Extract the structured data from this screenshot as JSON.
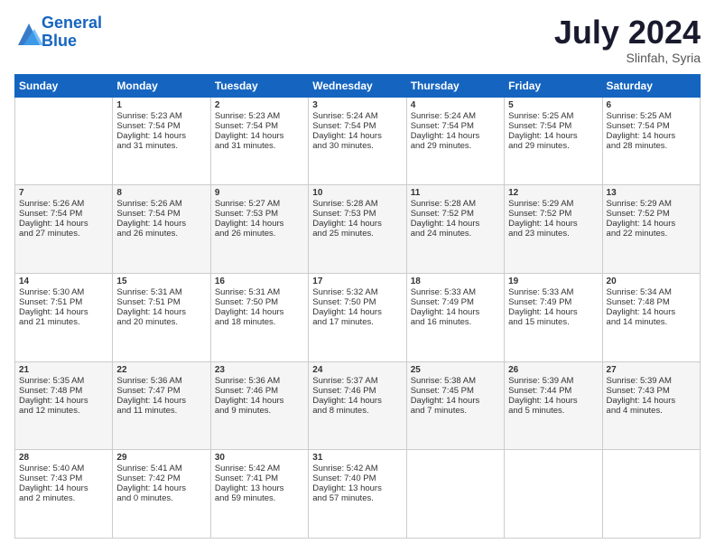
{
  "logo": {
    "line1": "General",
    "line2": "Blue"
  },
  "title": "July 2024",
  "location": "Slinfah, Syria",
  "days_of_week": [
    "Sunday",
    "Monday",
    "Tuesday",
    "Wednesday",
    "Thursday",
    "Friday",
    "Saturday"
  ],
  "weeks": [
    [
      {
        "day": "",
        "info": ""
      },
      {
        "day": "1",
        "info": "Sunrise: 5:23 AM\nSunset: 7:54 PM\nDaylight: 14 hours\nand 31 minutes."
      },
      {
        "day": "2",
        "info": "Sunrise: 5:23 AM\nSunset: 7:54 PM\nDaylight: 14 hours\nand 31 minutes."
      },
      {
        "day": "3",
        "info": "Sunrise: 5:24 AM\nSunset: 7:54 PM\nDaylight: 14 hours\nand 30 minutes."
      },
      {
        "day": "4",
        "info": "Sunrise: 5:24 AM\nSunset: 7:54 PM\nDaylight: 14 hours\nand 29 minutes."
      },
      {
        "day": "5",
        "info": "Sunrise: 5:25 AM\nSunset: 7:54 PM\nDaylight: 14 hours\nand 29 minutes."
      },
      {
        "day": "6",
        "info": "Sunrise: 5:25 AM\nSunset: 7:54 PM\nDaylight: 14 hours\nand 28 minutes."
      }
    ],
    [
      {
        "day": "7",
        "info": "Sunrise: 5:26 AM\nSunset: 7:54 PM\nDaylight: 14 hours\nand 27 minutes."
      },
      {
        "day": "8",
        "info": "Sunrise: 5:26 AM\nSunset: 7:54 PM\nDaylight: 14 hours\nand 26 minutes."
      },
      {
        "day": "9",
        "info": "Sunrise: 5:27 AM\nSunset: 7:53 PM\nDaylight: 14 hours\nand 26 minutes."
      },
      {
        "day": "10",
        "info": "Sunrise: 5:28 AM\nSunset: 7:53 PM\nDaylight: 14 hours\nand 25 minutes."
      },
      {
        "day": "11",
        "info": "Sunrise: 5:28 AM\nSunset: 7:52 PM\nDaylight: 14 hours\nand 24 minutes."
      },
      {
        "day": "12",
        "info": "Sunrise: 5:29 AM\nSunset: 7:52 PM\nDaylight: 14 hours\nand 23 minutes."
      },
      {
        "day": "13",
        "info": "Sunrise: 5:29 AM\nSunset: 7:52 PM\nDaylight: 14 hours\nand 22 minutes."
      }
    ],
    [
      {
        "day": "14",
        "info": "Sunrise: 5:30 AM\nSunset: 7:51 PM\nDaylight: 14 hours\nand 21 minutes."
      },
      {
        "day": "15",
        "info": "Sunrise: 5:31 AM\nSunset: 7:51 PM\nDaylight: 14 hours\nand 20 minutes."
      },
      {
        "day": "16",
        "info": "Sunrise: 5:31 AM\nSunset: 7:50 PM\nDaylight: 14 hours\nand 18 minutes."
      },
      {
        "day": "17",
        "info": "Sunrise: 5:32 AM\nSunset: 7:50 PM\nDaylight: 14 hours\nand 17 minutes."
      },
      {
        "day": "18",
        "info": "Sunrise: 5:33 AM\nSunset: 7:49 PM\nDaylight: 14 hours\nand 16 minutes."
      },
      {
        "day": "19",
        "info": "Sunrise: 5:33 AM\nSunset: 7:49 PM\nDaylight: 14 hours\nand 15 minutes."
      },
      {
        "day": "20",
        "info": "Sunrise: 5:34 AM\nSunset: 7:48 PM\nDaylight: 14 hours\nand 14 minutes."
      }
    ],
    [
      {
        "day": "21",
        "info": "Sunrise: 5:35 AM\nSunset: 7:48 PM\nDaylight: 14 hours\nand 12 minutes."
      },
      {
        "day": "22",
        "info": "Sunrise: 5:36 AM\nSunset: 7:47 PM\nDaylight: 14 hours\nand 11 minutes."
      },
      {
        "day": "23",
        "info": "Sunrise: 5:36 AM\nSunset: 7:46 PM\nDaylight: 14 hours\nand 9 minutes."
      },
      {
        "day": "24",
        "info": "Sunrise: 5:37 AM\nSunset: 7:46 PM\nDaylight: 14 hours\nand 8 minutes."
      },
      {
        "day": "25",
        "info": "Sunrise: 5:38 AM\nSunset: 7:45 PM\nDaylight: 14 hours\nand 7 minutes."
      },
      {
        "day": "26",
        "info": "Sunrise: 5:39 AM\nSunset: 7:44 PM\nDaylight: 14 hours\nand 5 minutes."
      },
      {
        "day": "27",
        "info": "Sunrise: 5:39 AM\nSunset: 7:43 PM\nDaylight: 14 hours\nand 4 minutes."
      }
    ],
    [
      {
        "day": "28",
        "info": "Sunrise: 5:40 AM\nSunset: 7:43 PM\nDaylight: 14 hours\nand 2 minutes."
      },
      {
        "day": "29",
        "info": "Sunrise: 5:41 AM\nSunset: 7:42 PM\nDaylight: 14 hours\nand 0 minutes."
      },
      {
        "day": "30",
        "info": "Sunrise: 5:42 AM\nSunset: 7:41 PM\nDaylight: 13 hours\nand 59 minutes."
      },
      {
        "day": "31",
        "info": "Sunrise: 5:42 AM\nSunset: 7:40 PM\nDaylight: 13 hours\nand 57 minutes."
      },
      {
        "day": "",
        "info": ""
      },
      {
        "day": "",
        "info": ""
      },
      {
        "day": "",
        "info": ""
      }
    ]
  ]
}
